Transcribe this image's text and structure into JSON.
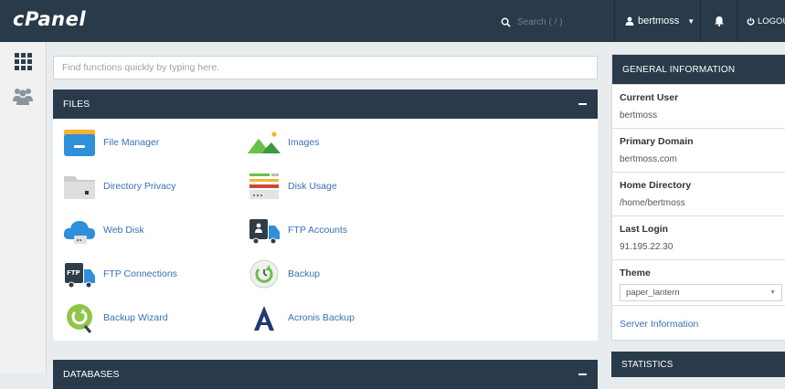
{
  "header": {
    "logo_text": "cPanel",
    "search_placeholder": "Search ( / )",
    "username": "bertmoss",
    "logout_label": "LOGOUT"
  },
  "find": {
    "placeholder": "Find functions quickly by typing here."
  },
  "files_panel": {
    "title": "FILES",
    "items": [
      {
        "label": "File Manager",
        "icon": "file-manager-icon"
      },
      {
        "label": "Images",
        "icon": "images-icon"
      },
      {
        "label": "Directory Privacy",
        "icon": "folder-lock-icon"
      },
      {
        "label": "Disk Usage",
        "icon": "disk-usage-icon"
      },
      {
        "label": "Web Disk",
        "icon": "cloud-icon"
      },
      {
        "label": "FTP Accounts",
        "icon": "ftp-truck-icon"
      },
      {
        "label": "FTP Connections",
        "icon": "ftp-connections-icon"
      },
      {
        "label": "Backup",
        "icon": "backup-icon"
      },
      {
        "label": "Backup Wizard",
        "icon": "backup-wizard-icon"
      },
      {
        "label": "Acronis Backup",
        "icon": "acronis-icon"
      }
    ]
  },
  "databases_panel": {
    "title": "DATABASES"
  },
  "general_info": {
    "title": "GENERAL INFORMATION",
    "rows": [
      {
        "label": "Current User",
        "value": "bertmoss"
      },
      {
        "label": "Primary Domain",
        "value": "bertmoss.com"
      },
      {
        "label": "Home Directory",
        "value": "/home/bertmoss"
      },
      {
        "label": "Last Login",
        "value": "91.195.22.30"
      }
    ],
    "theme_label": "Theme",
    "theme_value": "paper_lantern",
    "server_info_link": "Server Information"
  },
  "statistics": {
    "title": "STATISTICS"
  },
  "colors": {
    "header_bg": "#293a4a",
    "link": "#3a6fb4",
    "page_bg": "#e9ecef"
  }
}
